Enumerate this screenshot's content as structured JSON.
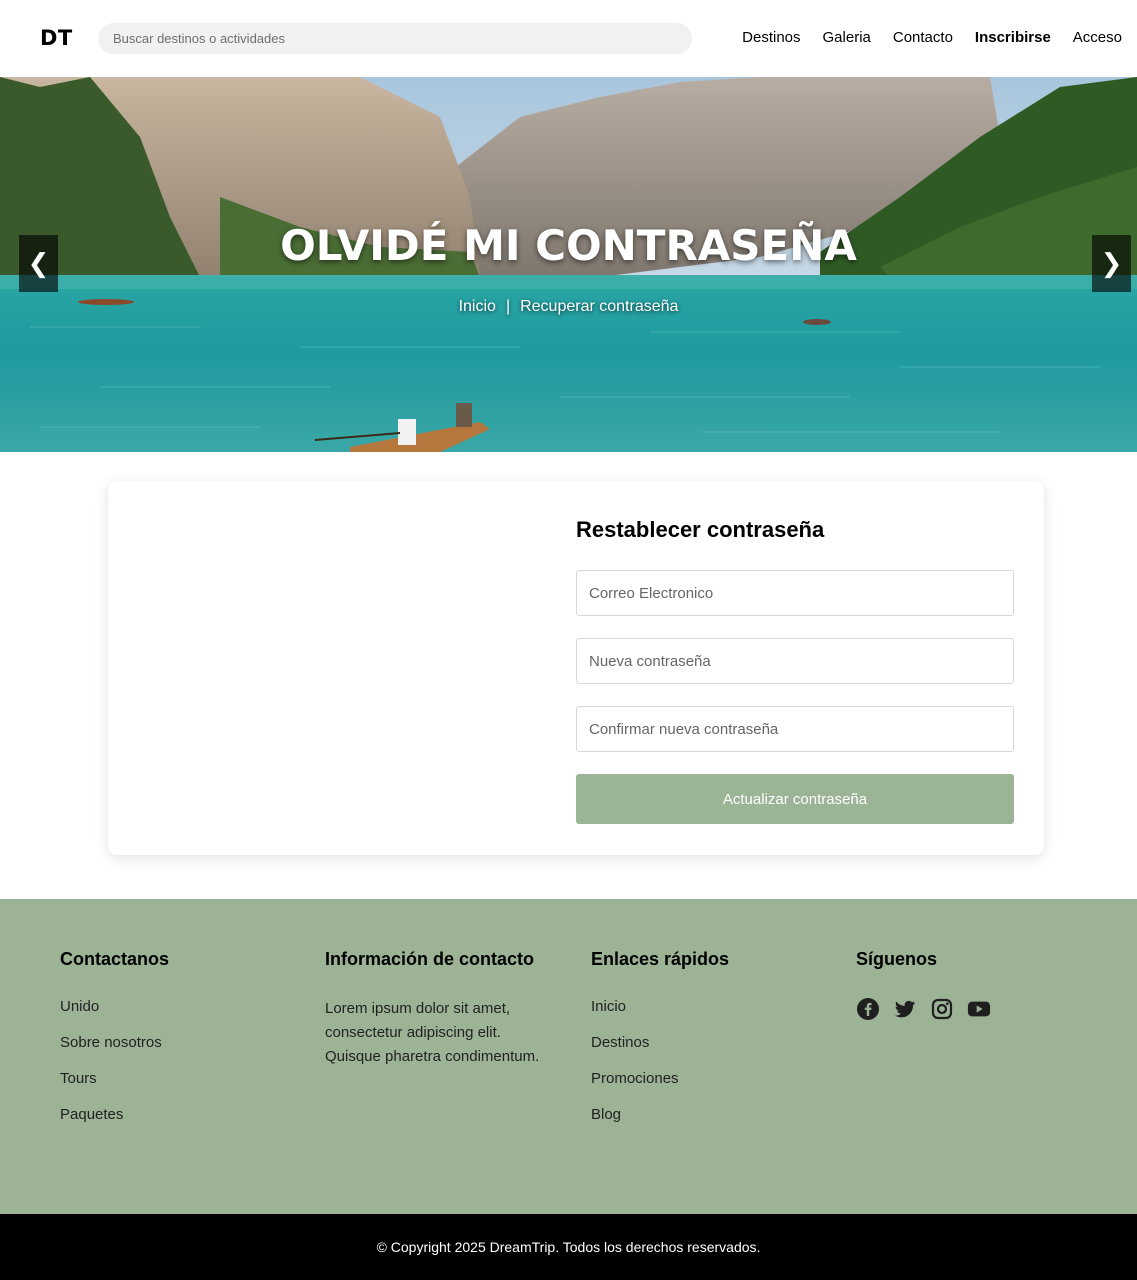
{
  "header": {
    "logo": "DT",
    "search_placeholder": "Buscar destinos o actividades",
    "nav": [
      {
        "label": "Destinos"
      },
      {
        "label": "Galeria"
      },
      {
        "label": "Contacto"
      },
      {
        "label": "Inscribirse"
      },
      {
        "label": "Acceso"
      }
    ]
  },
  "hero": {
    "title": "OLVIDÉ MI CONTRASEÑA",
    "breadcrumb_home": "Inicio",
    "breadcrumb_separator": "|",
    "breadcrumb_current": "Recuperar contraseña",
    "prev_icon": "chevron-left-icon",
    "next_icon": "chevron-right-icon",
    "prev_glyph": "❮",
    "next_glyph": "❯"
  },
  "form": {
    "title": "Restablecer contraseña",
    "email_placeholder": "Correo Electronico",
    "new_password_placeholder": "Nueva contraseña",
    "confirm_password_placeholder": "Confirmar nueva contraseña",
    "submit_label": "Actualizar contraseña",
    "accent_color": "#9cb496"
  },
  "footer": {
    "background_color": "#9cb396",
    "col1": {
      "title": "Contactanos",
      "items": [
        "Unido",
        "Sobre nosotros",
        "Tours",
        "Paquetes"
      ]
    },
    "col2": {
      "title": "Información de contacto",
      "text": "Lorem ipsum dolor sit amet, consectetur adipiscing elit. Quisque pharetra condimentum."
    },
    "col3": {
      "title": "Enlaces rápidos",
      "items": [
        "Inicio",
        "Destinos",
        "Promociones",
        "Blog"
      ]
    },
    "col4": {
      "title": "Síguenos",
      "icons": [
        "facebook-icon",
        "twitter-icon",
        "instagram-icon",
        "youtube-icon"
      ]
    },
    "copyright": "© Copyright 2025 DreamTrip. Todos los derechos reservados."
  }
}
